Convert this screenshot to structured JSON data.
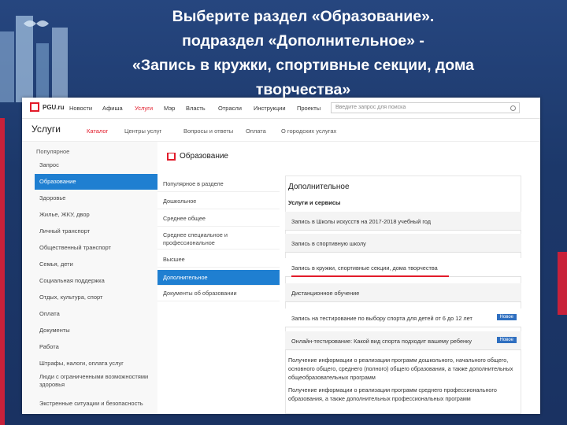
{
  "slide": {
    "title_lines": [
      "Выберите раздел «Образование».",
      "подраздел «Дополнительное» -",
      "«Запись в кружки, спортивные секции, дома",
      "творчества»"
    ],
    "colors": {
      "background": "#1d3a6e",
      "accent_red": "#c8213a",
      "active_blue": "#1f7fd1"
    }
  },
  "portal": {
    "logo_text": "PGU.ru",
    "nav": [
      "Новости",
      "Афиша",
      "Услуги",
      "Мэр",
      "Власть",
      "Отрасли",
      "Инструкции",
      "Проекты"
    ],
    "nav_active_index": 2,
    "search_placeholder": "Введите запрос для поиска",
    "subnav": {
      "title": "Услуги",
      "links": [
        "Каталог",
        "Центры услуг",
        "Вопросы и ответы",
        "Оплата",
        "О городских услугах"
      ],
      "active_index": 0
    },
    "categories": {
      "back_label": "Популярное",
      "items": [
        "Запрос",
        "Образование",
        "Здоровье",
        "Жилье, ЖКУ, двор",
        "Личный транспорт",
        "Общественный транспорт",
        "Семья, дети",
        "Социальная поддержка",
        "Отдых, культура, спорт",
        "Оплата",
        "Документы",
        "Работа",
        "Штрафы, налоги, оплата услуг",
        "Люди с ограниченными возможностями здоровья",
        "Экстренные ситуации и безопасность"
      ],
      "active_index": 1
    },
    "section": {
      "title": "Образование",
      "subsections": [
        "Популярное в разделе",
        "Дошкольное",
        "Среднее общее",
        "Среднее специальное и профессиональное",
        "Высшее",
        "Дополнительное",
        "Документы об образовании"
      ],
      "active_index": 5
    },
    "detail": {
      "title": "Дополнительное",
      "services_heading": "Услуги и сервисы",
      "services": [
        {
          "label": "Запись в Школы искусств на 2017-2018 учебный год",
          "badge": ""
        },
        {
          "label": "Запись в спортивную школу",
          "badge": ""
        },
        {
          "label": "Запись в кружки, спортивные секции, дома творчества",
          "badge": ""
        },
        {
          "label": "Дистанционное обучение",
          "badge": ""
        },
        {
          "label": "Запись на тестирование по выбору спорта для детей от 6 до 12 лет",
          "badge": "Новое"
        },
        {
          "label": "Онлайн-тестирование: Какой вид спорта подходит вашему ребенку",
          "badge": "Новое"
        }
      ],
      "highlighted_index": 2,
      "info_items": [
        "Получение информации о реализации программ дошкольного, начального общего, основного общего, среднего (полного) общего образования, а также дополнительных общеобразовательных программ",
        "Получение информации о реализации программ среднего профессионального образования, а также дополнительных профессиональных программ"
      ]
    }
  }
}
